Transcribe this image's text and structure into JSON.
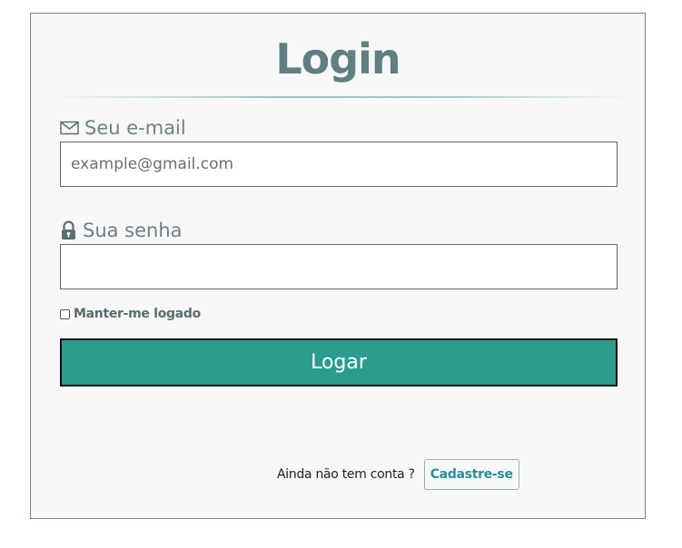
{
  "form": {
    "title": "Login",
    "email": {
      "label": "Seu e-mail",
      "icon": "envelope-icon",
      "placeholder": "example@gmail.com",
      "value": ""
    },
    "password": {
      "label": "Sua senha",
      "icon": "lock-icon",
      "placeholder": "",
      "value": ""
    },
    "remember": {
      "label": "Manter-me logado",
      "checked": false
    },
    "submit_label": "Logar",
    "signup": {
      "prompt": "Ainda não tem conta ?",
      "link_label": "Cadastre-se"
    }
  },
  "colors": {
    "accent": "#2a9d8f",
    "title": "#5f7f82",
    "label": "#6d8287",
    "link": "#2a8c9c",
    "card_background": "#f8f8f8"
  }
}
